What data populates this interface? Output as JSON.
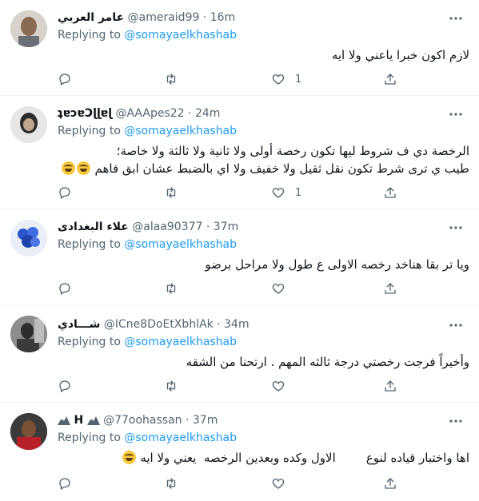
{
  "colors": {
    "accent": "#1d9bf0",
    "text": "#0f1419",
    "muted": "#536471",
    "divider": "#eff3f4"
  },
  "replies": [
    {
      "name": "عامر العربي",
      "handle": "@ameraid99",
      "dot": "·",
      "time": "16m",
      "replying_prefix": "Replying to",
      "mention": "@somayaelkhashab",
      "text_lines": [
        "لازم اكون خبرا ياعني ولا ايه"
      ],
      "emoji": "",
      "reply_count": "",
      "retweet_count": "",
      "like_count": "1"
    },
    {
      "name": "ʇɐɔɐƆɭɭɐɭ",
      "handle": "@AAApes22",
      "dot": "·",
      "time": "24m",
      "replying_prefix": "Replying to",
      "mention": "@somayaelkhashab",
      "text_lines": [
        "الرخصة دي ف شروط ليها تكون رخصة أولى ولا ثانية ولا ثالثة ولا خاصة؛",
        "طيب ي ترى شرط تكون نقل ثقيل ولا خفيف ولا اي بالضبط عشان ابق فاهم"
      ],
      "emoji": "😂😂",
      "reply_count": "",
      "retweet_count": "",
      "like_count": "1"
    },
    {
      "name": "علاء البغدادى",
      "handle": "@alaa90377",
      "dot": "·",
      "time": "37m",
      "replying_prefix": "Replying to",
      "mention": "@somayaelkhashab",
      "text_lines": [
        "ويا تر بقا هناخد رخصه الاولى ع طول ولا مراحل برضو"
      ],
      "emoji": "",
      "reply_count": "",
      "retweet_count": "",
      "like_count": ""
    },
    {
      "name": "شـــادي",
      "handle": "@ICne8DoEtXbhlAk",
      "dot": "·",
      "time": "34m",
      "replying_prefix": "Replying to",
      "mention": "@somayaelkhashab",
      "text_lines": [
        "وأخيراً فرجت رخصتي درجة ثالثه المهم . ارتحنا من الشقه"
      ],
      "emoji": "",
      "reply_count": "",
      "retweet_count": "",
      "like_count": ""
    },
    {
      "name": "H",
      "handle": "@77oohassan",
      "dot": "·",
      "time": "37m",
      "replying_prefix": "Replying to",
      "mention": "@somayaelkhashab",
      "text_lines": [
        "اها واختبار قياده لنوع        الاول وكده وبعدين الرخصه  يعني ولا ايه"
      ],
      "emoji": "😂",
      "reply_count": "",
      "retweet_count": "",
      "like_count": ""
    }
  ]
}
